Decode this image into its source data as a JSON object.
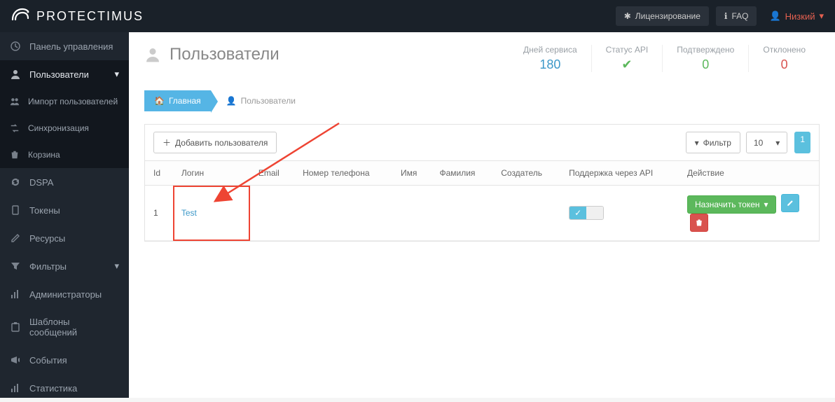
{
  "brand": "PROTECTIMUS",
  "topbar": {
    "licensing": "Лицензирование",
    "faq": "FAQ",
    "user": "Низкий"
  },
  "sidebar": {
    "dashboard": "Панель управления",
    "users": "Пользователи",
    "importUsers": "Импорт пользователей",
    "sync": "Синхронизация",
    "trash": "Корзина",
    "dspa": "DSPA",
    "tokens": "Токены",
    "resources": "Ресурсы",
    "filters": "Фильтры",
    "admins": "Администраторы",
    "templates": "Шаблоны сообщений",
    "events": "События",
    "stats": "Статистика"
  },
  "page": {
    "title": "Пользователи",
    "stats": {
      "daysLabel": "Дней сервиса",
      "daysValue": "180",
      "apiLabel": "Статус API",
      "confirmedLabel": "Подтверждено",
      "confirmedValue": "0",
      "rejectedLabel": "Отклонено",
      "rejectedValue": "0"
    },
    "breadcrumb": {
      "home": "Главная",
      "current": "Пользователи"
    },
    "toolbar": {
      "addUser": "Добавить пользователя",
      "filter": "Фильтр",
      "perPage": "10",
      "pageNum": "1"
    },
    "columns": {
      "id": "Id",
      "login": "Логин",
      "email": "Email",
      "phone": "Номер телефона",
      "name": "Имя",
      "surname": "Фамилия",
      "creator": "Создатель",
      "api": "Поддержка через API",
      "action": "Действие"
    },
    "rows": [
      {
        "id": "1",
        "login": "Test",
        "email": "",
        "phone": "",
        "name": "",
        "surname": "",
        "creator": "",
        "api": true
      }
    ],
    "assignToken": "Назначить токен"
  }
}
